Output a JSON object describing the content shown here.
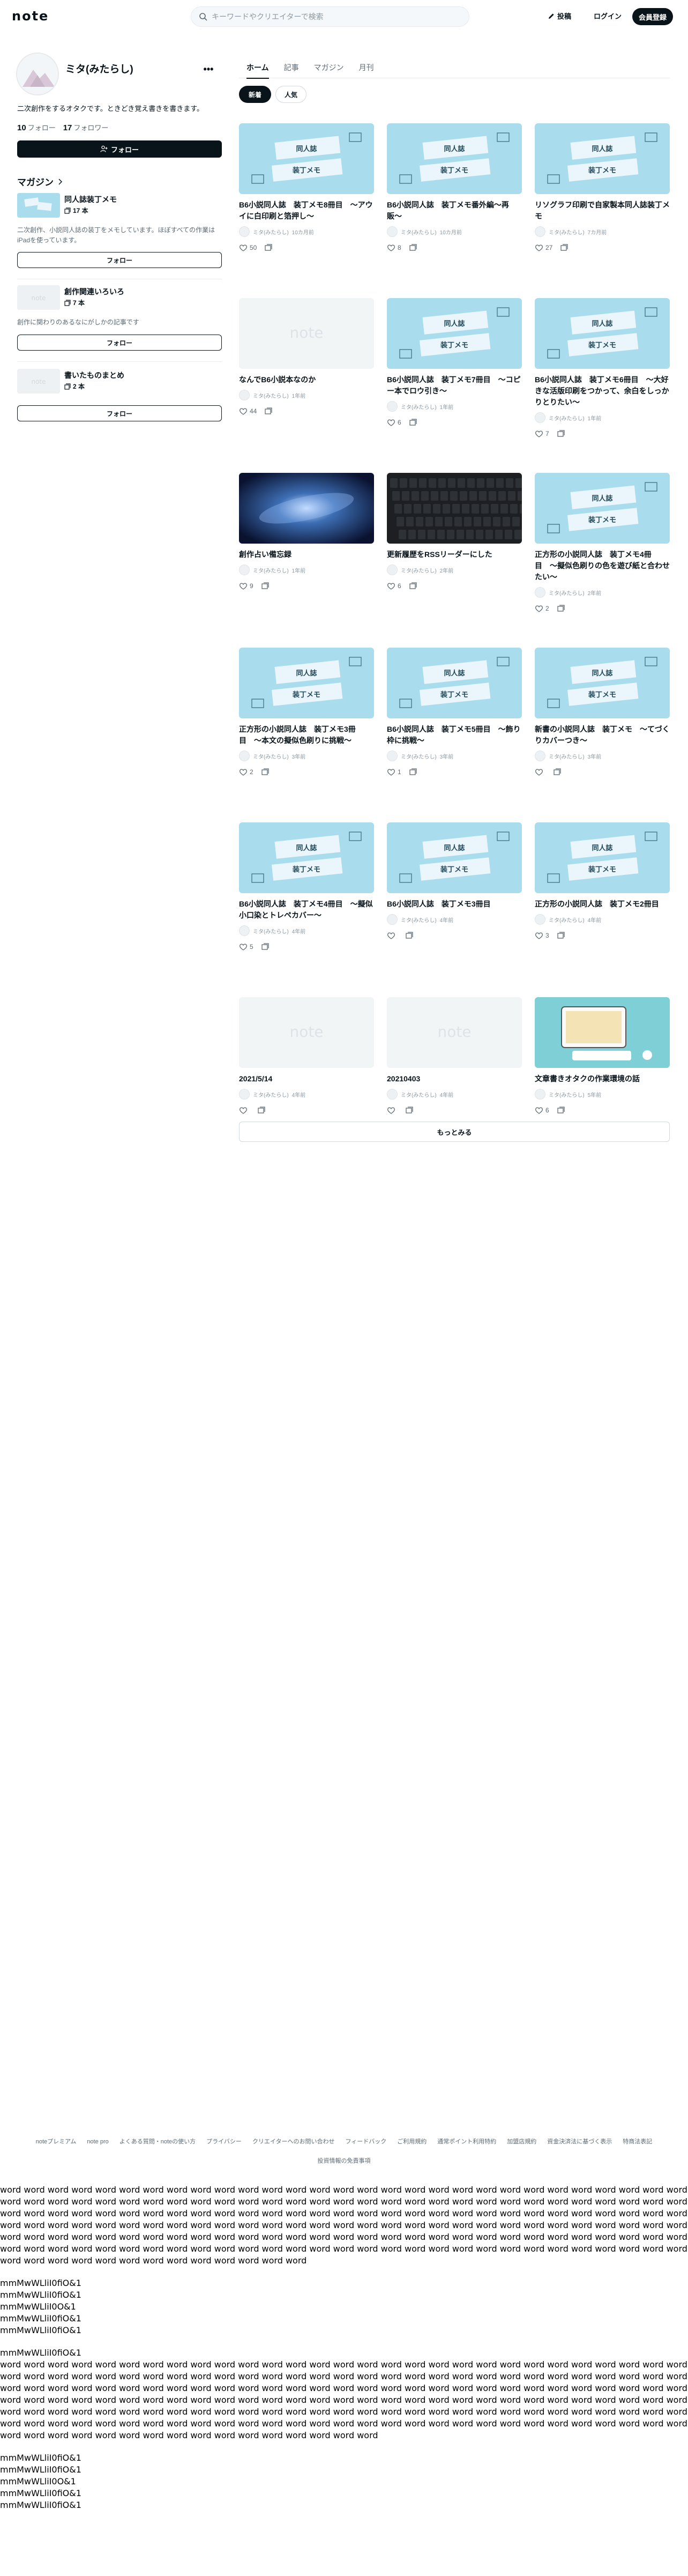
{
  "header": {
    "logo": "note",
    "search_placeholder": "キーワードやクリエイターで検索",
    "post_label": "投稿",
    "login_label": "ログイン",
    "signup_label": "会員登録"
  },
  "profile": {
    "name": "ミタ(みたらし)",
    "bio": "二次創作をするオタクです。ときどき覚え書きを書きます。",
    "following_count": "10",
    "following_label": "フォロー",
    "followers_count": "17",
    "followers_label": "フォロワー",
    "follow_button": "フォロー"
  },
  "magazines": {
    "heading": "マガジン",
    "items": [
      {
        "title": "同人誌装丁メモ",
        "count": "17 本",
        "desc": "二次創作、小説同人誌の装丁をメモしています。ほぼすべての作業はiPadを使っています。",
        "follow": "フォロー"
      },
      {
        "title": "創作関連いろいろ",
        "count": "7 本",
        "desc": "創作に関わりのあるなにがしかの記事です",
        "follow": "フォロー"
      },
      {
        "title": "書いたものまとめ",
        "count": "2 本",
        "desc": "",
        "follow": "フォロー"
      }
    ]
  },
  "tabs": [
    "ホーム",
    "記事",
    "マガジン",
    "月刊"
  ],
  "sort": {
    "new": "新着",
    "popular": "人気"
  },
  "author_short": "ミタ(みたらし)",
  "articles": [
    {
      "title": "B6小説同人誌　装丁メモ8冊目　〜アウイに白印刷と箔押し〜",
      "age": "10カ月前",
      "likes": "50",
      "thumb": "book"
    },
    {
      "title": "B6小説同人誌　装丁メモ番外編〜再販〜",
      "age": "10カ月前",
      "likes": "8",
      "thumb": "book"
    },
    {
      "title": "リソグラフ印刷で自家製本同人誌装丁メモ",
      "age": "7カ月前",
      "likes": "27",
      "thumb": "book"
    },
    {
      "title": "なんでB6小説本なのか",
      "age": "1年前",
      "likes": "44",
      "thumb": "note"
    },
    {
      "title": "B6小説同人誌　装丁メモ7冊目　〜コピー本でロウ引き〜",
      "age": "1年前",
      "likes": "6",
      "thumb": "book"
    },
    {
      "title": "B6小説同人誌　装丁メモ6冊目　〜大好きな活版印刷をつかって、余白をしっかりとりたい〜",
      "age": "1年前",
      "likes": "7",
      "thumb": "book"
    },
    {
      "title": "創作占い備忘録",
      "age": "1年前",
      "likes": "9",
      "thumb": "galaxy"
    },
    {
      "title": "更新履歴をRSSリーダーにした",
      "age": "2年前",
      "likes": "6",
      "thumb": "keyboard"
    },
    {
      "title": "正方形の小説同人誌　装丁メモ4冊目　〜擬似色刷りの色を遊び紙と合わせたい〜",
      "age": "2年前",
      "likes": "2",
      "thumb": "book"
    },
    {
      "title": "正方形の小説同人誌　装丁メモ3冊目　〜本文の擬似色刷りに挑戦〜",
      "age": "3年前",
      "likes": "2",
      "thumb": "book"
    },
    {
      "title": "B6小説同人誌　装丁メモ5冊目　〜飾り枠に挑戦〜",
      "age": "3年前",
      "likes": "1",
      "thumb": "book"
    },
    {
      "title": "新書の小説同人誌　装丁メモ　〜てづくりカバーつき〜",
      "age": "3年前",
      "likes": "",
      "thumb": "book"
    },
    {
      "title": "B6小説同人誌　装丁メモ4冊目　〜擬似小口染とトレペカバー〜",
      "age": "4年前",
      "likes": "5",
      "thumb": "book"
    },
    {
      "title": "B6小説同人誌　装丁メモ3冊目",
      "age": "4年前",
      "likes": "",
      "thumb": "book"
    },
    {
      "title": "正方形の小説同人誌　装丁メモ2冊目",
      "age": "4年前",
      "likes": "3",
      "thumb": "book"
    },
    {
      "title": "2021/5/14",
      "age": "4年前",
      "likes": "",
      "thumb": "note"
    },
    {
      "title": "20210403",
      "age": "4年前",
      "likes": "",
      "thumb": "note"
    },
    {
      "title": "文章書きオタクの作業環境の話",
      "age": "5年前",
      "likes": "6",
      "thumb": "desk"
    }
  ],
  "more_button": "もっとみる",
  "footer": {
    "row1": [
      "noteプレミアム",
      "note pro",
      "よくある質問・noteの使い方",
      "プライバシー",
      "クリエイターへのお問い合わせ",
      "フィードバック",
      "ご利用規約",
      "通常ポイント利用特約",
      "加盟店規約",
      "資金決済法に基づく表示",
      "特商法表記"
    ],
    "row2": [
      "投資情報の免責事項"
    ]
  },
  "test": {
    "words1": "word word word word word word word word word word word word word word word word word word word word word word word word word word word word word word word word word word word word word word word word word word word word word word word word word word word word word word word word word word word word word word word word word word word word word word word word word word word word word word word word word word word word word word word word word word word word word word word word word word word word word word word word word word word word word word word word word word word word word word word word word word word word word word word word word word word word word word word word word word word word word word word word word word word word word word word word word word word word word word word word word word word word word word word word word word word word word word word word word word word word word word word word word word word",
    "chars1": [
      "mmMwWLliI0fiO&1",
      "mmMwWLliI0fiO&1",
      "mmMwWLliI0O&1",
      "mmMwWLliI0fiO&1",
      "mmMwWLliI0fiO&1"
    ],
    "words2": "word word word word word word word word word word word word word word word word word word word word word word word word word word word word word word word word word word word word word word word word word word word word word word word word word word word word word word word word word word word word word word word word word word word word word word word word word word word word word word word word word word word word word word word word word word word word word word word word word word word word word word word word word word word word word word word word word word word word word word word word word word word word word word word word word word word word word word word word word word word word word word word word word word word word word word word word word word word word word word word word word word word word word word word word word word word word word word word word word word word word word word word word word word word word word word",
    "chars2": [
      "mmMwWLliI0fiO&1",
      "mmMwWLliI0fiO&1",
      "mmMwWLliI0O&1",
      "mmMwWLliI0fiO&1",
      "mmMwWLliI0fiO&1"
    ]
  }
}
